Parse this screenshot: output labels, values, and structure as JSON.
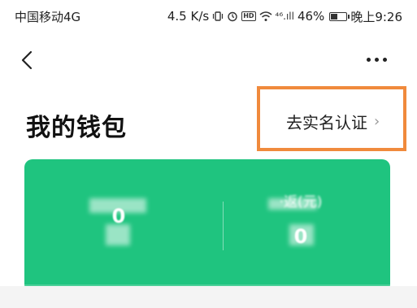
{
  "status_bar": {
    "carrier": "中国移动4G",
    "speed": "4.5 K/s",
    "hd": "HD",
    "signal": "⁴⁶.ıll",
    "battery_level": 0.46,
    "battery_text": "46%",
    "time": "晚上9:26"
  },
  "nav": {
    "back_icon": "chevron-left-icon",
    "more_icon": "more-dots-icon"
  },
  "page": {
    "title": "我的钱包"
  },
  "verify": {
    "label": "去实名认证",
    "chevron": "›"
  },
  "wallet_card": {
    "accent_color": "#1fc47f",
    "left": {
      "label": "",
      "value": "0"
    },
    "right": {
      "label": "·返(元)",
      "value": "0"
    }
  },
  "colors": {
    "highlight": "#f08a3c",
    "card": "#1fc47f"
  }
}
